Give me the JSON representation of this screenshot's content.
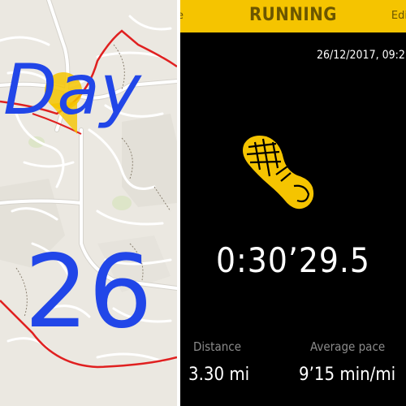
{
  "header": {
    "title": "RUNNING",
    "left_label": "e",
    "right_label": "Edi"
  },
  "workout": {
    "timestamp": "26/12/2017, 09:2",
    "duration": "0:30’29.5",
    "distance_label": "Distance",
    "distance_value": "3.30 mi",
    "pace_label": "Average pace",
    "pace_value": "9’15 min/mi"
  },
  "overlay": {
    "day_text": "Day",
    "number_text": "26"
  },
  "icons": {
    "workout": "shoe-sole-icon",
    "location": "location-pin-icon"
  },
  "colors": {
    "accent": "#f5c400",
    "route": "#e02020",
    "handwriting": "#2146e8",
    "background": "#000000",
    "map": "#ece9e2"
  }
}
